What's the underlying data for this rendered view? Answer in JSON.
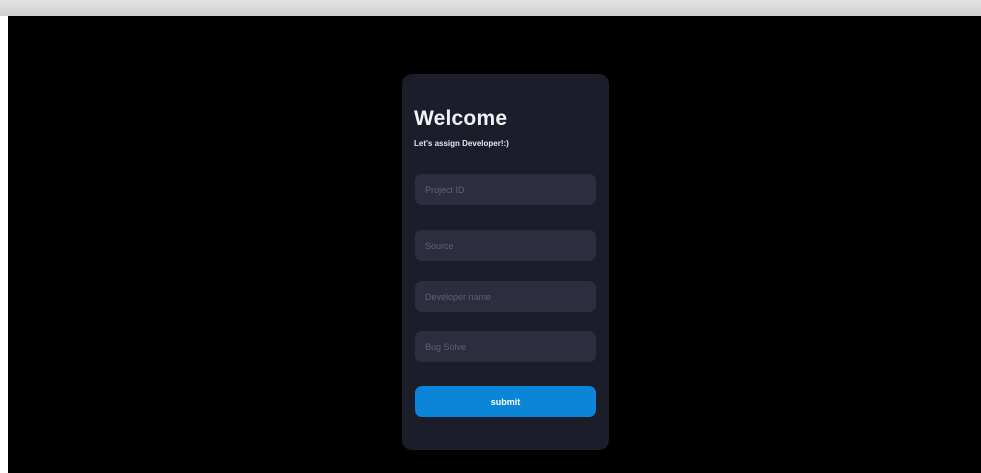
{
  "form": {
    "title": "Welcome",
    "subtitle": "Let's assign Developer!:)",
    "fields": [
      {
        "placeholder": "Project ID",
        "value": ""
      },
      {
        "placeholder": "Source",
        "value": ""
      },
      {
        "placeholder": "Developer name",
        "value": ""
      },
      {
        "placeholder": "Bug Solve",
        "value": ""
      }
    ],
    "submit_label": "submit"
  },
  "colors": {
    "background": "#000000",
    "card": "#1b1d2b",
    "input": "#2c2e3f",
    "accent": "#0a85d8"
  }
}
